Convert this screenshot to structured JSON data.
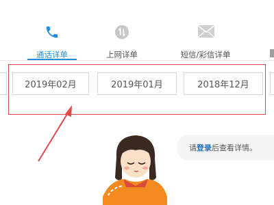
{
  "tabs": [
    {
      "label": "通话详单",
      "icon": "phone-icon",
      "active": true
    },
    {
      "label": "上网详单",
      "icon": "data-transfer-icon",
      "active": false
    },
    {
      "label": "短信/彩信详单",
      "icon": "envelope-icon",
      "active": false
    }
  ],
  "months": [
    "2019年02月",
    "2019年01月",
    "2018年12月"
  ],
  "login_prompt": {
    "prefix": "请",
    "link": "登录",
    "suffix": "后查看详情。"
  },
  "colors": {
    "accent": "#1e8fde",
    "annotation": "#e4464a",
    "icon_gray": "#c7c7c7"
  }
}
